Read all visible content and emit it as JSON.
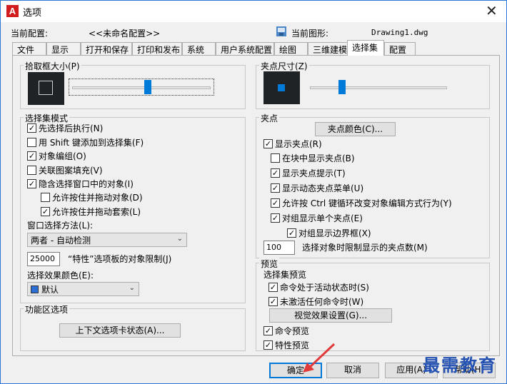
{
  "window": {
    "title": "选项",
    "close_icon": "close-icon"
  },
  "profile": {
    "current_config_label": "当前配置:",
    "current_config_value": "<<未命名配置>>",
    "current_drawing_label": "当前图形:",
    "current_drawing_value": "Drawing1.dwg"
  },
  "tabs": [
    {
      "label": "文件"
    },
    {
      "label": "显示"
    },
    {
      "label": "打开和保存"
    },
    {
      "label": "打印和发布"
    },
    {
      "label": "系统"
    },
    {
      "label": "用户系统配置"
    },
    {
      "label": "绘图"
    },
    {
      "label": "三维建模"
    },
    {
      "label": "选择集"
    },
    {
      "label": "配置"
    }
  ],
  "active_tab": "选择集",
  "pickbox": {
    "title": "拾取框大小(P)",
    "level": 0.55
  },
  "grip_size": {
    "title": "夹点尺寸(Z)",
    "level": 0.22
  },
  "selection_modes": {
    "title": "选择集模式",
    "items": [
      {
        "label": "先选择后执行(N)",
        "checked": true,
        "indent": 0
      },
      {
        "label": "用 Shift 键添加到选择集(F)",
        "checked": false,
        "indent": 0
      },
      {
        "label": "对象编组(O)",
        "checked": true,
        "indent": 0
      },
      {
        "label": "关联图案填充(V)",
        "checked": false,
        "indent": 0
      },
      {
        "label": "隐含选择窗口中的对象(I)",
        "checked": true,
        "indent": 0
      },
      {
        "label": "允许按住并拖动对象(D)",
        "checked": false,
        "indent": 1
      },
      {
        "label": "允许按住并拖动套索(L)",
        "checked": true,
        "indent": 1
      }
    ],
    "window_method_label": "窗口选择方法(L):",
    "window_method_value": "两者 - 自动检测",
    "limit_value": "25000",
    "limit_label": "“特性”选项板的对象限制(J)",
    "effect_color_label": "选择效果颜色(E):",
    "effect_color_value": "默认",
    "effect_color_swatch": "#2e6fd6"
  },
  "ribbon": {
    "title": "功能区选项",
    "button": "上下文选项卡状态(A)..."
  },
  "grips": {
    "title": "夹点",
    "color_button": "夹点颜色(C)...",
    "items": [
      {
        "label": "显示夹点(R)",
        "checked": true,
        "indent": 0
      },
      {
        "label": "在块中显示夹点(B)",
        "checked": false,
        "indent": 1
      },
      {
        "label": "显示夹点提示(T)",
        "checked": true,
        "indent": 1
      },
      {
        "label": "显示动态夹点菜单(U)",
        "checked": true,
        "indent": 1
      },
      {
        "label": "允许按 Ctrl 键循环改变对象编辑方式行为(Y)",
        "checked": true,
        "indent": 1
      },
      {
        "label": "对组显示单个夹点(E)",
        "checked": true,
        "indent": 1
      },
      {
        "label": "对组显示边界框(X)",
        "checked": true,
        "indent": 2
      }
    ],
    "limit_value": "100",
    "limit_label": "选择对象时限制显示的夹点数(M)"
  },
  "preview": {
    "title": "预览",
    "subtitle": "选择集预览",
    "items": [
      {
        "label": "命令处于活动状态时(S)",
        "checked": true
      },
      {
        "label": "未激活任何命令时(W)",
        "checked": true
      }
    ],
    "visual_button": "视觉效果设置(G)...",
    "items2": [
      {
        "label": "命令预览",
        "checked": true
      },
      {
        "label": "特性预览",
        "checked": true
      }
    ]
  },
  "footer": {
    "ok": "确定",
    "cancel": "取消",
    "apply": "应用(A)",
    "help": "帮助(H)"
  },
  "watermark": "最需教育",
  "colors": {
    "accent": "#0078d7",
    "brand_red": "#d11d1d",
    "arrow_red": "#e03a3a"
  }
}
